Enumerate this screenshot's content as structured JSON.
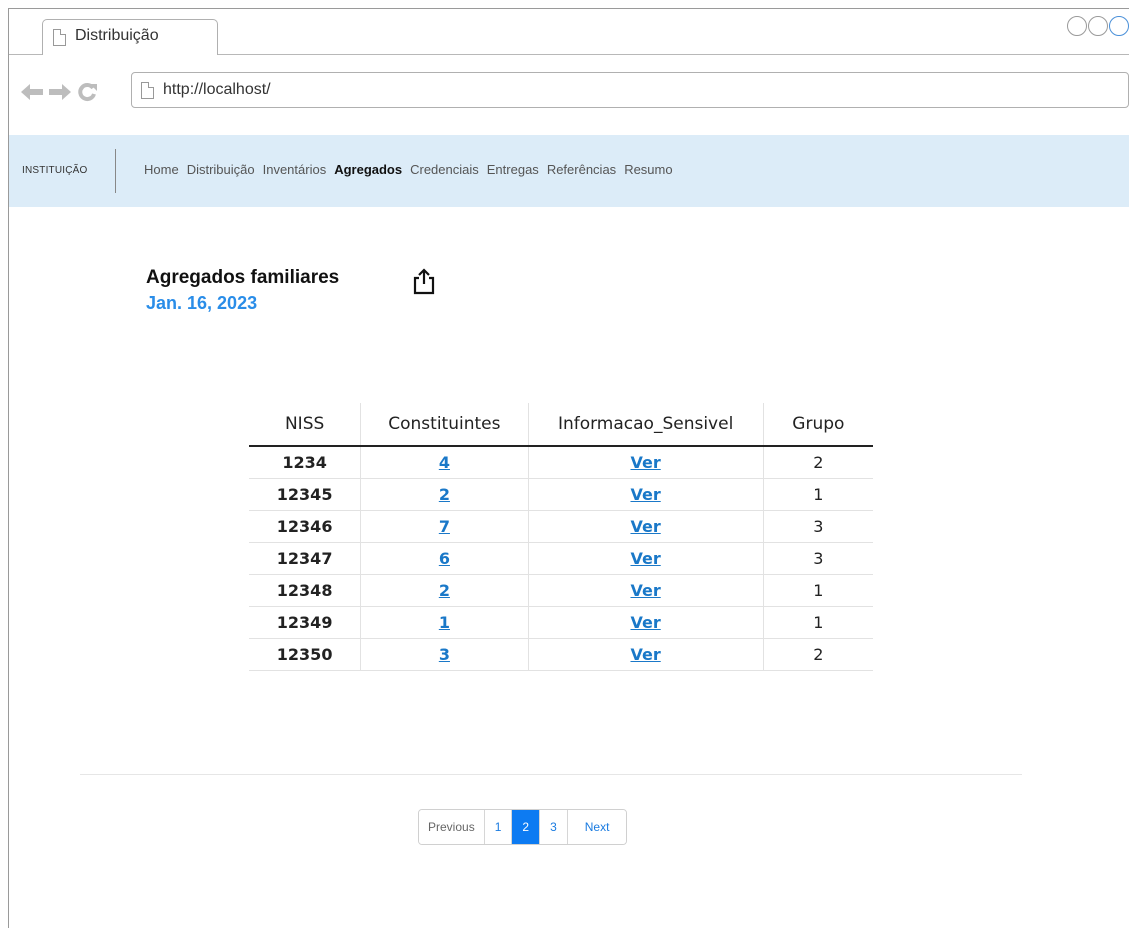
{
  "browser": {
    "tab_title": "Distribuição",
    "url": "http://localhost/"
  },
  "nav": {
    "brand": "INSTITUIÇÃO",
    "items": [
      {
        "label": "Home"
      },
      {
        "label": "Distribuição"
      },
      {
        "label": "Inventários"
      },
      {
        "label": "Agregados",
        "active": true
      },
      {
        "label": "Credenciais"
      },
      {
        "label": "Entregas"
      },
      {
        "label": "Referências"
      },
      {
        "label": "Resumo"
      }
    ]
  },
  "page": {
    "title": "Agregados familiares",
    "date": "Jan. 16, 2023",
    "share_icon": "share-icon"
  },
  "table": {
    "headers": [
      "NISS",
      "Constituintes",
      "Informacao_Sensivel",
      "Grupo"
    ],
    "rows": [
      {
        "niss": "1234",
        "constituintes": "4",
        "info": "Ver",
        "grupo": "2"
      },
      {
        "niss": "12345",
        "constituintes": "2",
        "info": "Ver",
        "grupo": "1"
      },
      {
        "niss": "12346",
        "constituintes": "7",
        "info": "Ver",
        "grupo": "3"
      },
      {
        "niss": "12347",
        "constituintes": "6",
        "info": "Ver",
        "grupo": "3"
      },
      {
        "niss": "12348",
        "constituintes": "2",
        "info": "Ver",
        "grupo": "1"
      },
      {
        "niss": "12349",
        "constituintes": "1",
        "info": "Ver",
        "grupo": "1"
      },
      {
        "niss": "12350",
        "constituintes": "3",
        "info": "Ver",
        "grupo": "2"
      }
    ]
  },
  "pagination": {
    "previous": "Previous",
    "pages": [
      "1",
      "2",
      "3"
    ],
    "current": "2",
    "next": "Next"
  },
  "colors": {
    "nav_bg": "#dcecf8",
    "date": "#2a8de8",
    "link": "#1a78c8",
    "page_active": "#0d7bf2"
  }
}
